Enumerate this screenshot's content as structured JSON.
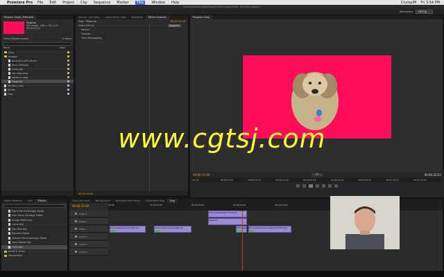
{
  "menubar": {
    "app": "Premiere Pro",
    "items": [
      "File",
      "Edit",
      "Project",
      "Clip",
      "Sequence",
      "Marker",
      "Title",
      "Window",
      "Help"
    ],
    "active_index": 6,
    "clock": "Fri 3:54 PM",
    "user": "ChoispiM"
  },
  "window_title": "/Users/lasteetew/Desktop/Greenscreen/Green_Premiere.prproj *",
  "workspace": {
    "label": "Workspace:",
    "value": "Editing"
  },
  "project": {
    "tabs": [
      "Project: Green_Premiere",
      "Media Browser",
      "Info",
      "Effects"
    ],
    "clip_name": "Magenta",
    "clip_info1": "Still Image, 1280 x 720 (1.0)",
    "clip_info2": "00;00;05;00",
    "project_file": "Green_Premiere.prproj",
    "items_count": "11 Items",
    "col_name": "Name",
    "col_label": "Label",
    "items": [
      {
        "name": "Clips",
        "kind": "folder",
        "color": "#d8b13a",
        "indent": 0
      },
      {
        "name": "Images",
        "kind": "folder",
        "color": "#d8b13a",
        "indent": 0
      },
      {
        "name": "backyard-with-fence",
        "kind": "file",
        "color": "#b8a57a",
        "indent": 1
      },
      {
        "name": "blue_road.jpg",
        "kind": "file",
        "color": "#b8a57a",
        "indent": 1
      },
      {
        "name": "grass.jpg",
        "kind": "file",
        "color": "#b8a57a",
        "indent": 1
      },
      {
        "name": "old-map.jpeg",
        "kind": "file",
        "color": "#b8a57a",
        "indent": 1
      },
      {
        "name": "patterns.jpeg",
        "kind": "file",
        "color": "#b8a57a",
        "indent": 1
      },
      {
        "name": "Magenta",
        "kind": "file",
        "color": "#b8a57a",
        "indent": 1,
        "selected": true
      },
      {
        "name": "Renders_dog",
        "kind": "file",
        "color": "#8fb4e8",
        "indent": 0
      },
      {
        "name": "White",
        "kind": "file",
        "color": "#b8a57a",
        "indent": 0
      },
      {
        "name": "Dog",
        "kind": "file",
        "color": "#8fb4e8",
        "indent": 0
      }
    ]
  },
  "effect_controls": {
    "tabs": [
      "Source: (no clips)",
      "Audio Mixer: Dog",
      "Metadata",
      "Effect Controls"
    ],
    "header": "Dog * Magenta",
    "timecode": "00;00;15;00",
    "clip_label": "Magenta",
    "section": "Video Effects",
    "rows": [
      "Motion",
      "Opacity",
      "Time Remapping"
    ],
    "bottom_tc": "00;00;15;00"
  },
  "program": {
    "tab": "Program: Dog",
    "timecode_left": "00;00;15;00",
    "timecode_right": "00;00;22;03",
    "fit": "Fit",
    "ruler_labels": [
      "00;00",
      "00;00;04;29",
      "00;00;09;29",
      "00;00;14;29",
      "00;00;19;29",
      "00;00;24;29",
      "00;00;29;29",
      "00;00;34;29",
      "00;00;39;29"
    ]
  },
  "effects_panel": {
    "tabs": [
      "Media Browser",
      "Info",
      "Effects"
    ],
    "items": [
      "Eight-Point Garbage Matte",
      "Four-Point Garbage Matte",
      "Image Matte Key",
      "Luma Key",
      "Non Red Key",
      "Remove Matte",
      "Sixteen-Point Garbage Matte",
      "Track Matte Key",
      "Ultra Key"
    ],
    "folders": [
      "Noise & Grain",
      "Perspective"
    ]
  },
  "timeline": {
    "tabs": [
      "Clips (no clips)",
      "Background",
      "backyard-with-fence",
      "Wireframe_dog",
      "Dog"
    ],
    "timecode": "00;00;15;00",
    "ruler_labels": [
      "00;00",
      "00;00;04;29",
      "00;00;09;29",
      "00;00;14;29",
      "00;00;19;29"
    ],
    "tracks": [
      "Video 3",
      "Video 2",
      "Video 1",
      "Audio 1",
      "Audio 2",
      "Audio 3"
    ],
    "clips": {
      "v3a": "ChromaKeyGreen-PixelLock",
      "v2": "Magenta",
      "v1a": "ChromaKeyGreen-PixelLock",
      "v1b": "ChromaKeyGreen-PixelLock",
      "v1c": "ChromaKeyGreen-PixelLock",
      "v1d": "ChromaKeyGreen-withclient-870.psd"
    }
  },
  "watermark": "www.cgtsj.com",
  "icons": [
    "apple-icon",
    "play-icon",
    "step-back-icon",
    "step-forward-icon",
    "loop-icon",
    "safe-margins-icon",
    "export-frame-icon",
    "lock-icon",
    "eye-icon",
    "speaker-icon"
  ]
}
